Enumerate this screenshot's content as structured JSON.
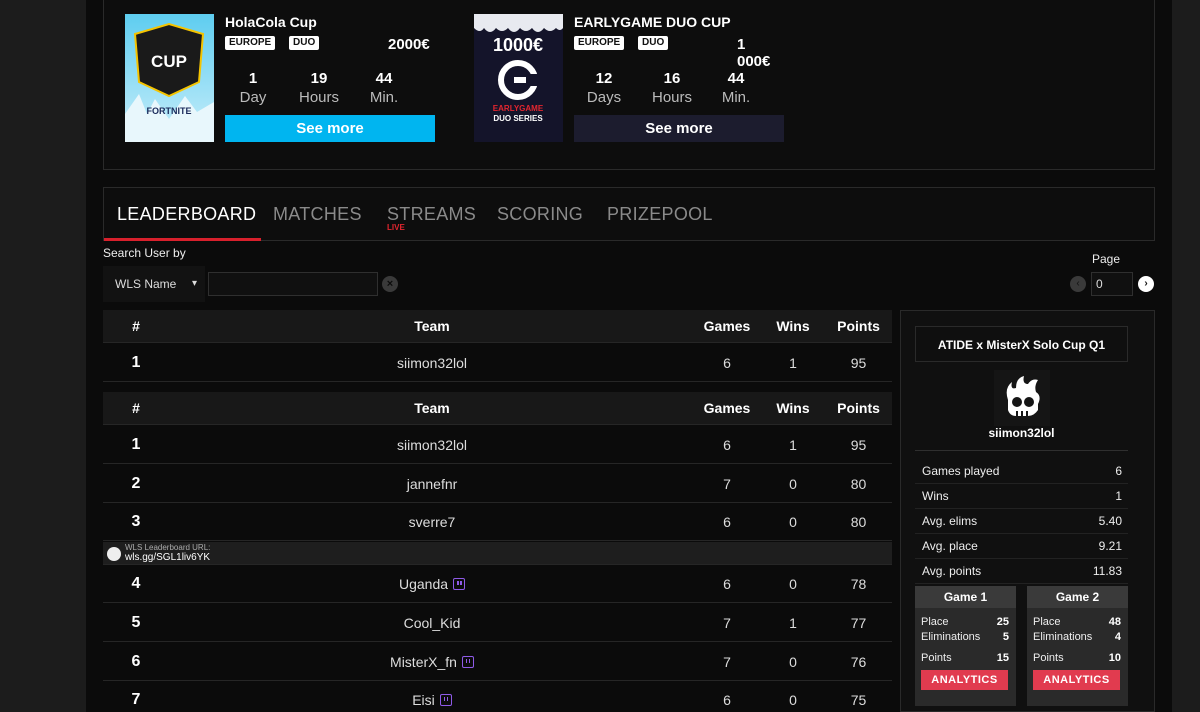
{
  "cups": [
    {
      "title": "HolaCola Cup",
      "region": "EUROPE",
      "mode": "DUO",
      "prize": "2000€",
      "countdown": [
        {
          "value": "1",
          "unit": "Day"
        },
        {
          "value": "19",
          "unit": "Hours"
        },
        {
          "value": "44",
          "unit": "Min."
        }
      ],
      "button": "See more",
      "button_color": "#00b5f0",
      "art": {
        "line1": "CUP",
        "line2": "FORTNITE"
      }
    },
    {
      "title": "EARLYGAME DUO CUP",
      "region": "EUROPE",
      "mode": "DUO",
      "prize": "1 000€",
      "countdown": [
        {
          "value": "12",
          "unit": "Days"
        },
        {
          "value": "16",
          "unit": "Hours"
        },
        {
          "value": "44",
          "unit": "Min."
        }
      ],
      "button": "See more",
      "button_color": "#1c1c2e",
      "art": {
        "line1": "1000€",
        "line2": "EARLYGAME",
        "line3": "DUO SERIES"
      }
    }
  ],
  "tabs": [
    {
      "label": "LEADERBOARD",
      "active": true
    },
    {
      "label": "MATCHES"
    },
    {
      "label": "STREAMS",
      "badge": "LIVE"
    },
    {
      "label": "SCORING"
    },
    {
      "label": "PRIZEPOOL"
    }
  ],
  "search": {
    "label": "Search User by",
    "select_value": "WLS Name",
    "input_value": ""
  },
  "pagination": {
    "label": "Page",
    "value": "0"
  },
  "table": {
    "headers": {
      "rank": "#",
      "team": "Team",
      "games": "Games",
      "wins": "Wins",
      "points": "Points"
    },
    "highlight_row": {
      "rank": "1",
      "team": "siimon32lol",
      "games": "6",
      "wins": "1",
      "points": "95"
    },
    "rows": [
      {
        "rank": "1",
        "team": "siimon32lol",
        "games": "6",
        "wins": "1",
        "points": "95"
      },
      {
        "rank": "2",
        "team": "jannefnr",
        "games": "7",
        "wins": "0",
        "points": "80"
      },
      {
        "rank": "3",
        "team": "sverre7",
        "games": "6",
        "wins": "0",
        "points": "80"
      },
      {
        "rank": "4",
        "team": "Uganda",
        "games": "6",
        "wins": "0",
        "points": "78",
        "twitch": true
      },
      {
        "rank": "5",
        "team": "Cool_Kid",
        "games": "7",
        "wins": "1",
        "points": "77"
      },
      {
        "rank": "6",
        "team": "MisterX_fn",
        "games": "7",
        "wins": "0",
        "points": "76",
        "twitch": true
      },
      {
        "rank": "7",
        "team": "Eisi",
        "games": "6",
        "wins": "0",
        "points": "75",
        "twitch": true
      }
    ],
    "url_banner": {
      "label": "WLS Leaderboard URL:",
      "value": "wls.gg/SGL1liv6YK"
    }
  },
  "side_panel": {
    "title": "ATIDE x MisterX Solo Cup Q1",
    "username": "siimon32lol",
    "stats": [
      {
        "label": "Games played",
        "value": "6"
      },
      {
        "label": "Wins",
        "value": "1"
      },
      {
        "label": "Avg. elims",
        "value": "5.40"
      },
      {
        "label": "Avg. place",
        "value": "9.21"
      },
      {
        "label": "Avg. points",
        "value": "11.83"
      }
    ],
    "games": [
      {
        "title": "Game 1",
        "place_label": "Place",
        "place": "25",
        "elims_label": "Eliminations",
        "elims": "5",
        "points_label": "Points",
        "points": "15",
        "button": "ANALYTICS"
      },
      {
        "title": "Game 2",
        "place_label": "Place",
        "place": "48",
        "elims_label": "Eliminations",
        "elims": "4",
        "points_label": "Points",
        "points": "10",
        "button": "ANALYTICS"
      }
    ]
  }
}
